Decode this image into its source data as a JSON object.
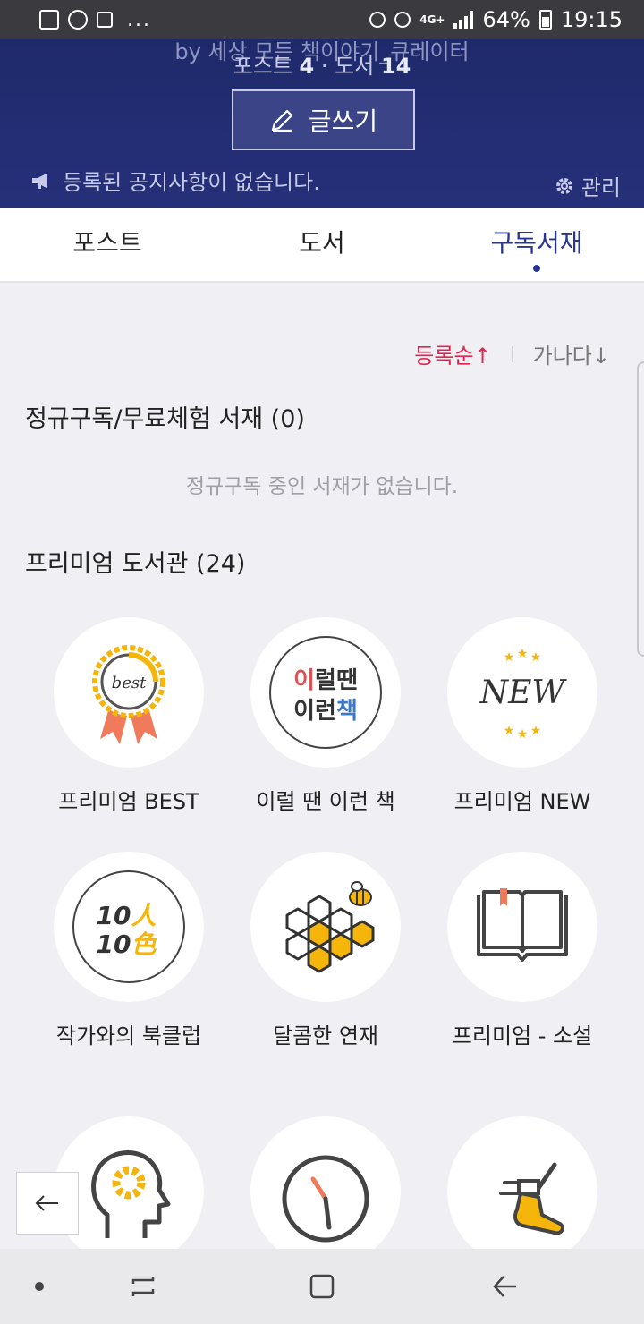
{
  "status_bar": {
    "battery": "64%",
    "time": "19:15",
    "network": "4G+",
    "more": "..."
  },
  "header": {
    "author_line": "by 세상 모든 책이야기_큐레이터",
    "stats_posts_label": "포스트",
    "stats_posts_count": "4",
    "stats_sep": "·",
    "stats_books_label": "도서",
    "stats_books_count": "14",
    "write_label": "글쓰기",
    "notice": "등록된 공지사항이 없습니다.",
    "manage_label": "관리"
  },
  "tabs": [
    {
      "label": "포스트",
      "active": false
    },
    {
      "label": "도서",
      "active": false
    },
    {
      "label": "구독서재",
      "active": true
    }
  ],
  "sort": {
    "option_a": "등록순↑",
    "option_b": "가나다↓",
    "active": "option_a"
  },
  "subscription": {
    "title": "정규구독/무료체험 서재 (0)",
    "empty": "정규구독 중인 서재가 없습니다."
  },
  "premium": {
    "title": "프리미엄 도서관 (24)",
    "items": [
      {
        "label": "프리미엄 BEST",
        "icon": "best-ribbon-icon",
        "icon_text": "best"
      },
      {
        "label": "이럴 땐 이런 책",
        "icon": "text-logo-icon",
        "icon_text_1a": "이",
        "icon_text_1b": "럴땐",
        "icon_text_2a": "이런",
        "icon_text_2b": "책"
      },
      {
        "label": "프리미엄 NEW",
        "icon": "new-stars-icon",
        "icon_text": "NEW"
      },
      {
        "label": "작가와의 북클럽",
        "icon": "ten-people-icon",
        "icon_text_1a": "10",
        "icon_text_1b": "人",
        "icon_text_2a": "10",
        "icon_text_2b": "色"
      },
      {
        "label": "달콤한 연재",
        "icon": "honeycomb-bee-icon"
      },
      {
        "label": "프리미엄 - 소설",
        "icon": "open-book-icon"
      },
      {
        "label": "",
        "icon": "head-gear-icon"
      },
      {
        "label": "",
        "icon": "clock-icon"
      },
      {
        "label": "",
        "icon": "running-shoe-icon"
      }
    ]
  },
  "colors": {
    "header_bg": "#26307a",
    "accent": "#2a3590",
    "sort_active": "#e0254f",
    "honey": "#f5b50a",
    "ribbon": "#f07b5c"
  }
}
